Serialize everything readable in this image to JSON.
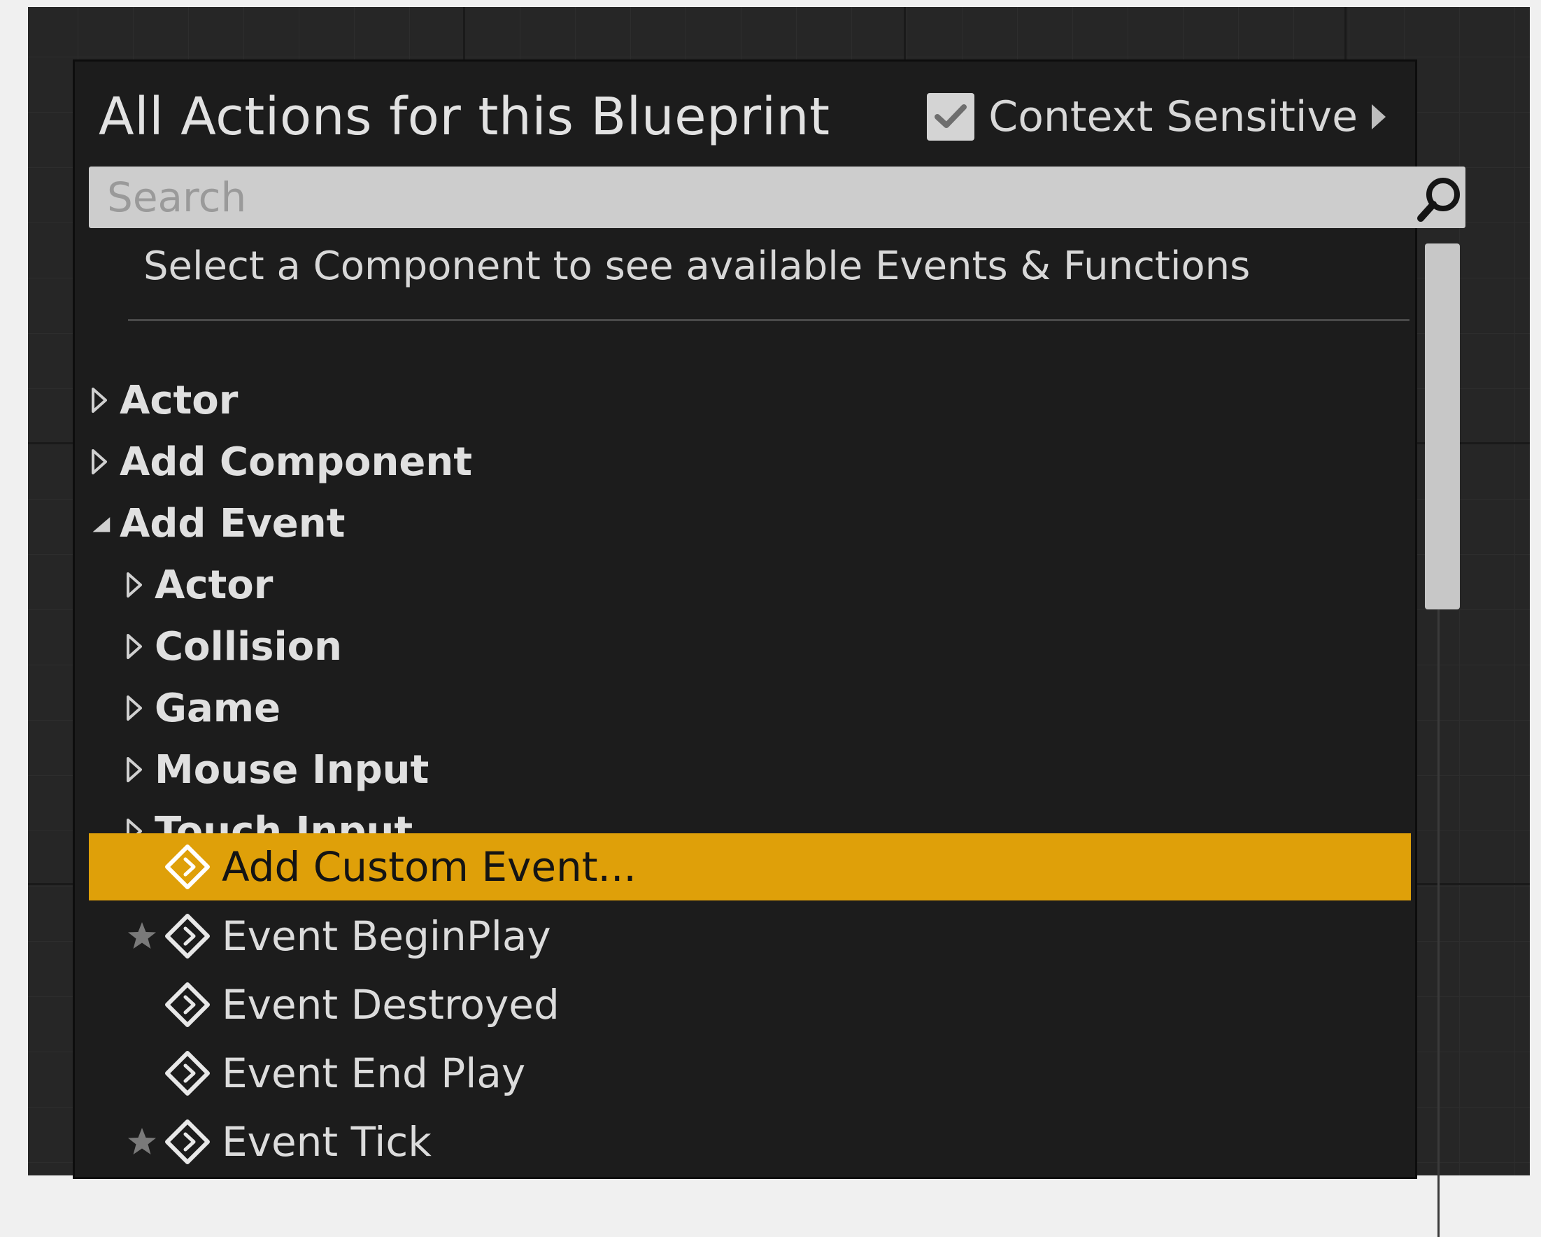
{
  "panel": {
    "title": "All Actions for this Blueprint",
    "context_sensitive": {
      "label": "Context Sensitive",
      "checked": true
    }
  },
  "search": {
    "placeholder": "Search",
    "value": ""
  },
  "hint": "Select a Component to see available Events & Functions",
  "tree": {
    "top_categories": [
      {
        "label": "Actor",
        "expanded": false
      },
      {
        "label": "Add Component",
        "expanded": false
      },
      {
        "label": "Add Event",
        "expanded": true
      }
    ],
    "add_event_subcategories": [
      {
        "label": "Actor",
        "expanded": false
      },
      {
        "label": "Collision",
        "expanded": false
      },
      {
        "label": "Game",
        "expanded": false
      },
      {
        "label": "Mouse Input",
        "expanded": false
      },
      {
        "label": "Touch Input",
        "expanded": false
      }
    ],
    "actions": [
      {
        "label": "Add Custom Event...",
        "selected": true,
        "favorite": false
      },
      {
        "label": "Event BeginPlay",
        "selected": false,
        "favorite": true
      },
      {
        "label": "Event Destroyed",
        "selected": false,
        "favorite": false
      },
      {
        "label": "Event End Play",
        "selected": false,
        "favorite": false
      },
      {
        "label": "Event Tick",
        "selected": false,
        "favorite": true
      }
    ]
  },
  "colors": {
    "selection": "#dfa009",
    "panel": "#1c1c1c",
    "graph": "#262626"
  },
  "icons": {
    "search": "search-icon",
    "checkbox": "checkmark-icon",
    "collapsed": "triangle-right-outline-icon",
    "expanded": "triangle-down-filled-icon",
    "event": "event-diamond-icon",
    "favorite": "star-icon"
  }
}
